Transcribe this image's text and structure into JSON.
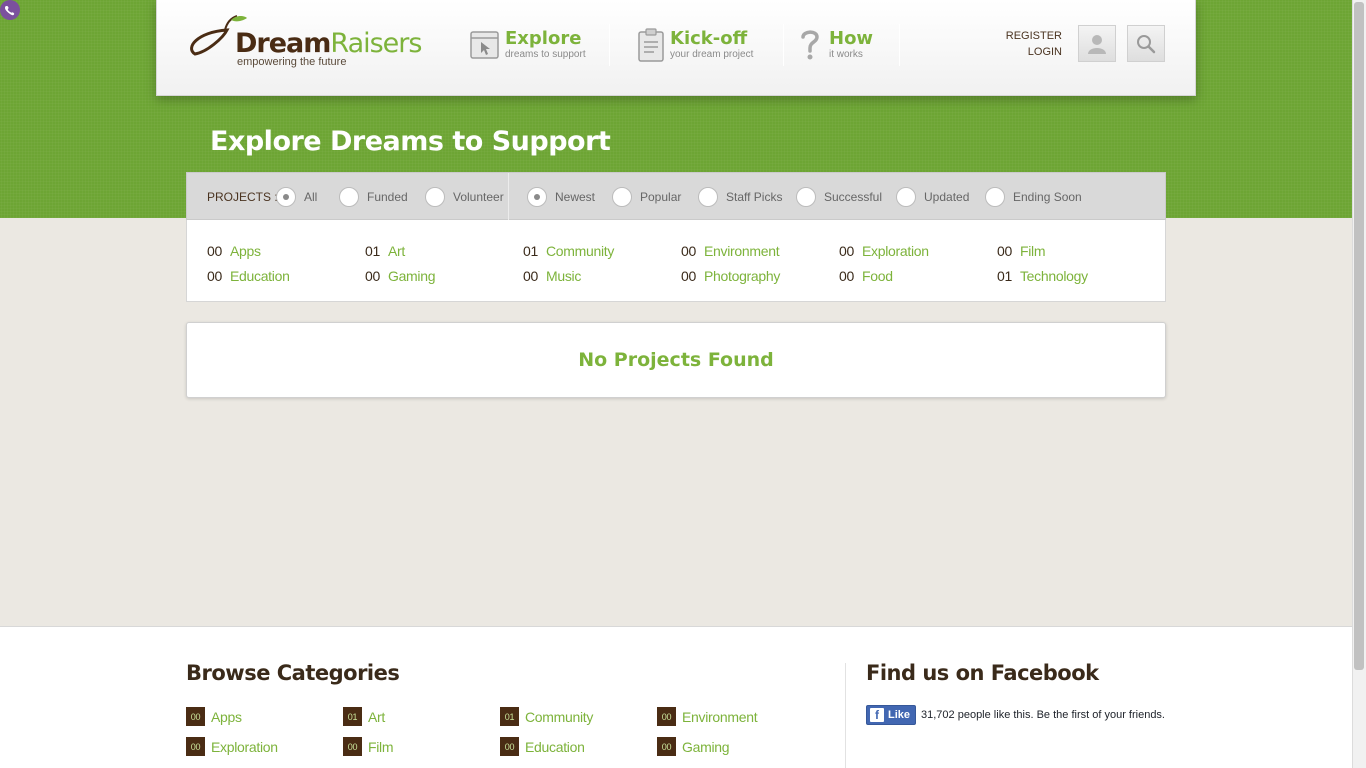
{
  "header": {
    "logo": {
      "dream": "Dream",
      "raisers": "Raisers",
      "tagline": "empowering the future"
    },
    "nav": [
      {
        "title": "Explore",
        "subtitle": "dreams to support",
        "icon": "browser-cursor-icon"
      },
      {
        "title": "Kick-off",
        "subtitle": "your dream project",
        "icon": "clipboard-icon"
      },
      {
        "title": "How",
        "subtitle": "it works",
        "icon": "question-mark-icon"
      }
    ],
    "register": "REGISTER",
    "login": "LOGIN"
  },
  "page": {
    "title": "Explore Dreams to Support"
  },
  "filters": {
    "label": "PROJECTS :",
    "status": [
      {
        "label": "All",
        "checked": true
      },
      {
        "label": "Funded",
        "checked": false
      },
      {
        "label": "Volunteer",
        "checked": false
      }
    ],
    "sort": [
      {
        "label": "Newest",
        "checked": true
      },
      {
        "label": "Popular",
        "checked": false
      },
      {
        "label": "Staff Picks",
        "checked": false
      },
      {
        "label": "Successful",
        "checked": false
      },
      {
        "label": "Updated",
        "checked": false
      },
      {
        "label": "Ending Soon",
        "checked": false
      }
    ]
  },
  "categories": [
    {
      "count": "00",
      "name": "Apps"
    },
    {
      "count": "01",
      "name": "Art"
    },
    {
      "count": "01",
      "name": "Community"
    },
    {
      "count": "00",
      "name": "Environment"
    },
    {
      "count": "00",
      "name": "Exploration"
    },
    {
      "count": "00",
      "name": "Film"
    },
    {
      "count": "00",
      "name": "Education"
    },
    {
      "count": "00",
      "name": "Gaming"
    },
    {
      "count": "00",
      "name": "Music"
    },
    {
      "count": "00",
      "name": "Photography"
    },
    {
      "count": "00",
      "name": "Food"
    },
    {
      "count": "01",
      "name": "Technology"
    }
  ],
  "results": {
    "empty_message": "No Projects Found"
  },
  "footer": {
    "browse_heading": "Browse Categories",
    "browse": [
      {
        "count": "00",
        "name": "Apps"
      },
      {
        "count": "01",
        "name": "Art"
      },
      {
        "count": "01",
        "name": "Community"
      },
      {
        "count": "00",
        "name": "Environment"
      },
      {
        "count": "00",
        "name": "Exploration"
      },
      {
        "count": "00",
        "name": "Film"
      },
      {
        "count": "00",
        "name": "Education"
      },
      {
        "count": "00",
        "name": "Gaming"
      }
    ],
    "facebook_heading": "Find us on Facebook",
    "fb_like": "Like",
    "fb_text": "31,702 people like this. Be the first of your friends."
  },
  "colors": {
    "brand_green": "#7db33b",
    "brand_brown": "#4a2c14",
    "facebook_blue": "#4267b2"
  }
}
